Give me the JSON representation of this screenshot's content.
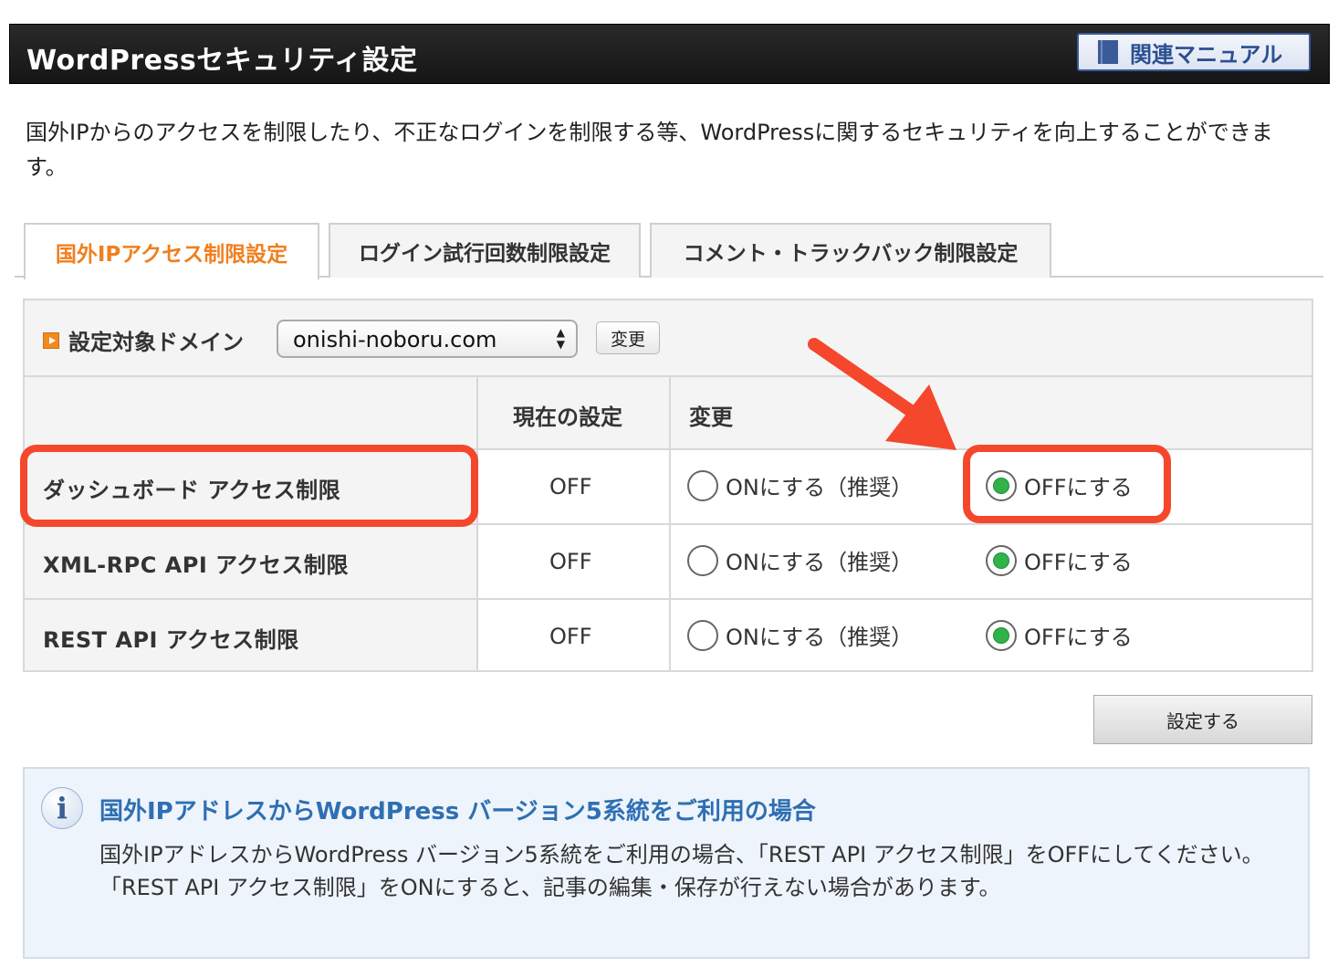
{
  "header": {
    "title": "WordPressセキュリティ設定",
    "manual_button": "関連マニュアル"
  },
  "description": "国外IPからのアクセスを制限したり、不正なログインを制限する等、WordPressに関するセキュリティを向上することができます。",
  "tabs": [
    {
      "label": "国外IPアクセス制限設定",
      "active": true
    },
    {
      "label": "ログイン試行回数制限設定",
      "active": false
    },
    {
      "label": "コメント・トラックバック制限設定",
      "active": false
    }
  ],
  "domain": {
    "label": "設定対象ドメイン",
    "selected": "onishi-noboru.com",
    "change_button": "変更"
  },
  "table": {
    "headers": {
      "current": "現在の設定",
      "change": "変更"
    },
    "rows": [
      {
        "label": "ダッシュボード アクセス制限",
        "current": "OFF",
        "on_label": "ONにする（推奨）",
        "off_label": "OFFにする",
        "selected": "off"
      },
      {
        "label": "XML-RPC API アクセス制限",
        "current": "OFF",
        "on_label": "ONにする（推奨）",
        "off_label": "OFFにする",
        "selected": "off"
      },
      {
        "label": "REST API アクセス制限",
        "current": "OFF",
        "on_label": "ONにする（推奨）",
        "off_label": "OFFにする",
        "selected": "off"
      }
    ]
  },
  "submit_button": "設定する",
  "info": {
    "title": "国外IPアドレスからWordPress バージョン5系統をご利用の場合",
    "text": "国外IPアドレスからWordPress バージョン5系統をご利用の場合、「REST API アクセス制限」をOFFにしてください。「REST API アクセス制限」をONにすると、記事の編集・保存が行えない場合があります。"
  },
  "colors": {
    "header_bg": "#1e1e1e",
    "active_tab": "#f07f1f",
    "radio_checked": "#31b34a",
    "annotation": "#f4472c",
    "info_title": "#2e6fb3"
  }
}
